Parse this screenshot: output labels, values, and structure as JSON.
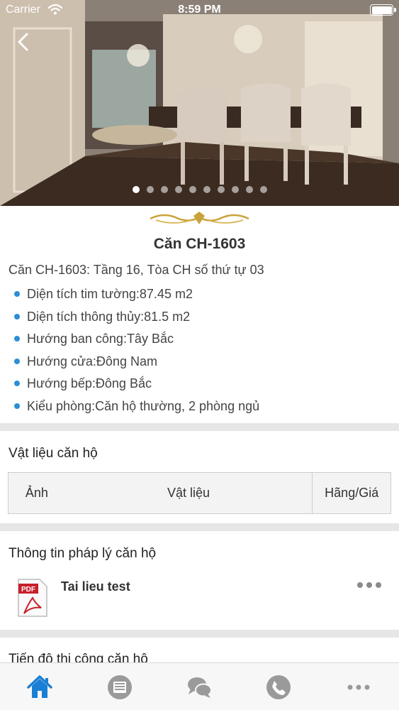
{
  "status_bar": {
    "carrier": "Carrier",
    "time": "8:59 PM"
  },
  "hero": {
    "slide_count": 10,
    "active_slide": 0
  },
  "apartment": {
    "title": "Căn CH-1603",
    "subtitle": "Căn CH-1603: Tầng 16, Tòa CH số thứ tự 03",
    "specs": [
      "Diện tích tim tường:87.45 m2",
      "Diện tích thông thủy:81.5 m2",
      "Hướng ban công:Tây Bắc",
      "Hướng cửa:Đông Nam",
      "Hướng bếp:Đông Bắc",
      "Kiểu phòng:Căn hộ thường, 2 phòng ngủ"
    ]
  },
  "materials": {
    "title": "Vật liệu căn hộ",
    "columns": [
      "Ảnh",
      "Vật liệu",
      "Hãng/Giá"
    ]
  },
  "legal": {
    "title": "Thông tin pháp lý căn hộ",
    "documents": [
      {
        "name": "Tai lieu test",
        "icon": "pdf-icon",
        "pdf_label": "PDF"
      }
    ]
  },
  "progress": {
    "title": "Tiến độ thi công căn hộ"
  },
  "tabbar": {
    "tabs": [
      {
        "name": "home",
        "icon": "home-icon",
        "active": true
      },
      {
        "name": "news",
        "icon": "news-icon",
        "active": false
      },
      {
        "name": "chat",
        "icon": "chat-icon",
        "active": false
      },
      {
        "name": "phone",
        "icon": "phone-icon",
        "active": false
      },
      {
        "name": "more",
        "icon": "more-icon",
        "active": false
      }
    ],
    "active_color": "#1a7fd4",
    "inactive_color": "#9a9a9a"
  },
  "colors": {
    "accent": "#2a8fd6",
    "ornament": "#c9a23a"
  }
}
